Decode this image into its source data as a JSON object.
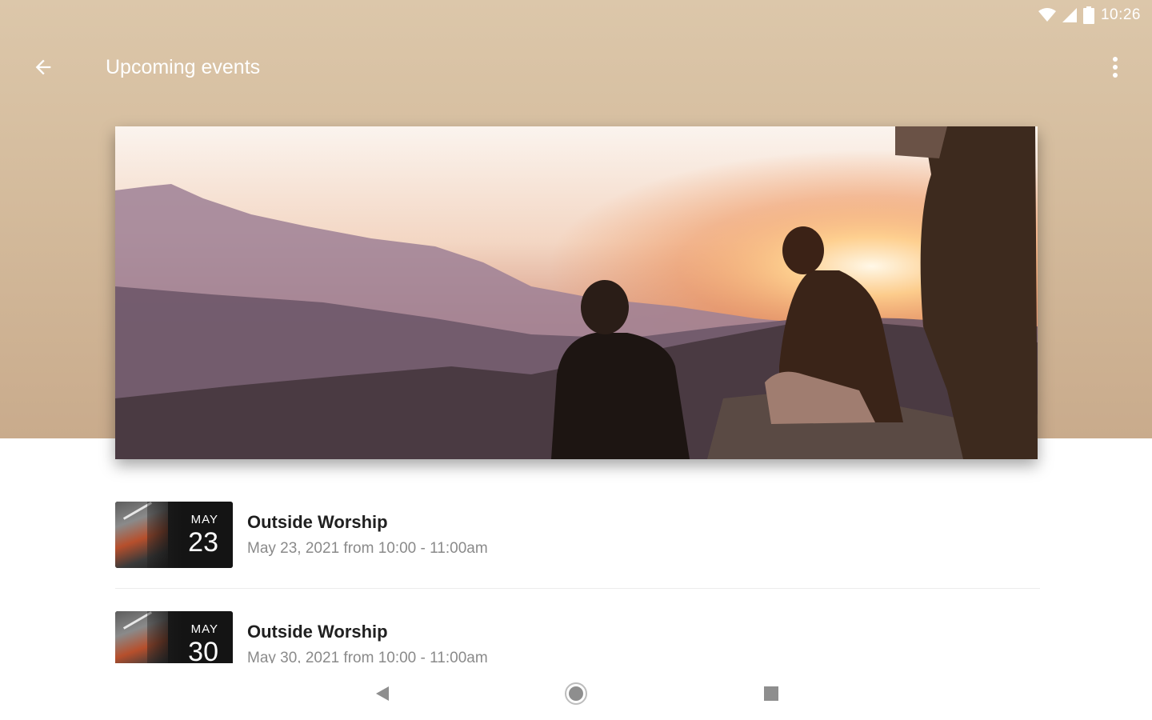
{
  "status_bar": {
    "time": "10:26",
    "icons": [
      "wifi-icon",
      "signal-icon",
      "battery-icon"
    ]
  },
  "app_bar": {
    "title": "Upcoming events",
    "back_icon": "arrow-back-icon",
    "menu_icon": "more-vert-icon"
  },
  "hero": {
    "image": "sunset-mountain-people-photo"
  },
  "events": [
    {
      "month": "MAY",
      "day": "23",
      "title": "Outside Worship",
      "time": "May 23, 2021 from 10:00 - 11:00am"
    },
    {
      "month": "MAY",
      "day": "30",
      "title": "Outside Worship",
      "time": "May 30, 2021 from 10:00 - 11:00am"
    }
  ],
  "nav_bar": {
    "icons": [
      "nav-back-icon",
      "nav-home-icon",
      "nav-recents-icon"
    ]
  },
  "colors": {
    "header_background": "#d4bb9c",
    "title_text": "#ffffff",
    "event_title": "#202020",
    "event_time": "#8a8a8a"
  }
}
